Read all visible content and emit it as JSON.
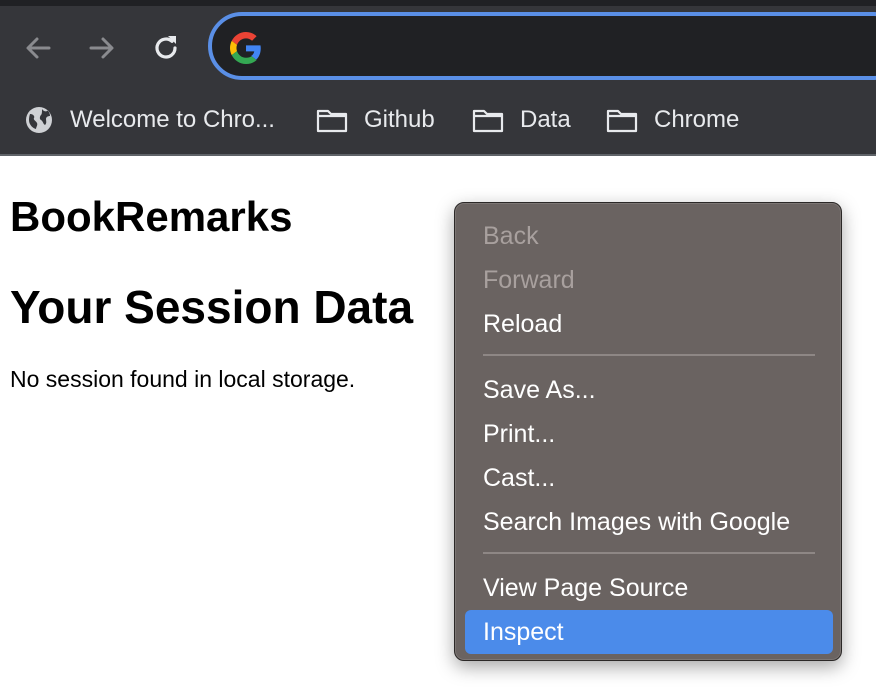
{
  "toolbar": {
    "back_icon": "arrow-left-icon",
    "forward_icon": "arrow-right-icon",
    "reload_icon": "reload-icon",
    "omnibox": {
      "value": "",
      "icon": "google-g-icon"
    },
    "colors": {
      "bg": "#35363a",
      "omnibox_border": "#5a8fe6"
    }
  },
  "bookmarks": [
    {
      "label": "Welcome to Chro...",
      "icon": "globe-icon"
    },
    {
      "label": "Github",
      "icon": "folder-icon"
    },
    {
      "label": "Data",
      "icon": "folder-icon"
    },
    {
      "label": "Chrome",
      "icon": "folder-icon"
    }
  ],
  "page": {
    "title": "BookRemarks",
    "heading": "Your Session Data",
    "message": "No session found in local storage."
  },
  "context_menu": {
    "items": [
      {
        "label": "Back",
        "state": "disabled"
      },
      {
        "label": "Forward",
        "state": "disabled"
      },
      {
        "label": "Reload",
        "state": "enabled"
      },
      {
        "label": "Save As...",
        "state": "enabled"
      },
      {
        "label": "Print...",
        "state": "enabled"
      },
      {
        "label": "Cast...",
        "state": "enabled"
      },
      {
        "label": "Search Images with Google",
        "state": "enabled"
      },
      {
        "label": "View Page Source",
        "state": "enabled"
      },
      {
        "label": "Inspect",
        "state": "selected"
      }
    ],
    "selected_color": "#4b8bea"
  }
}
